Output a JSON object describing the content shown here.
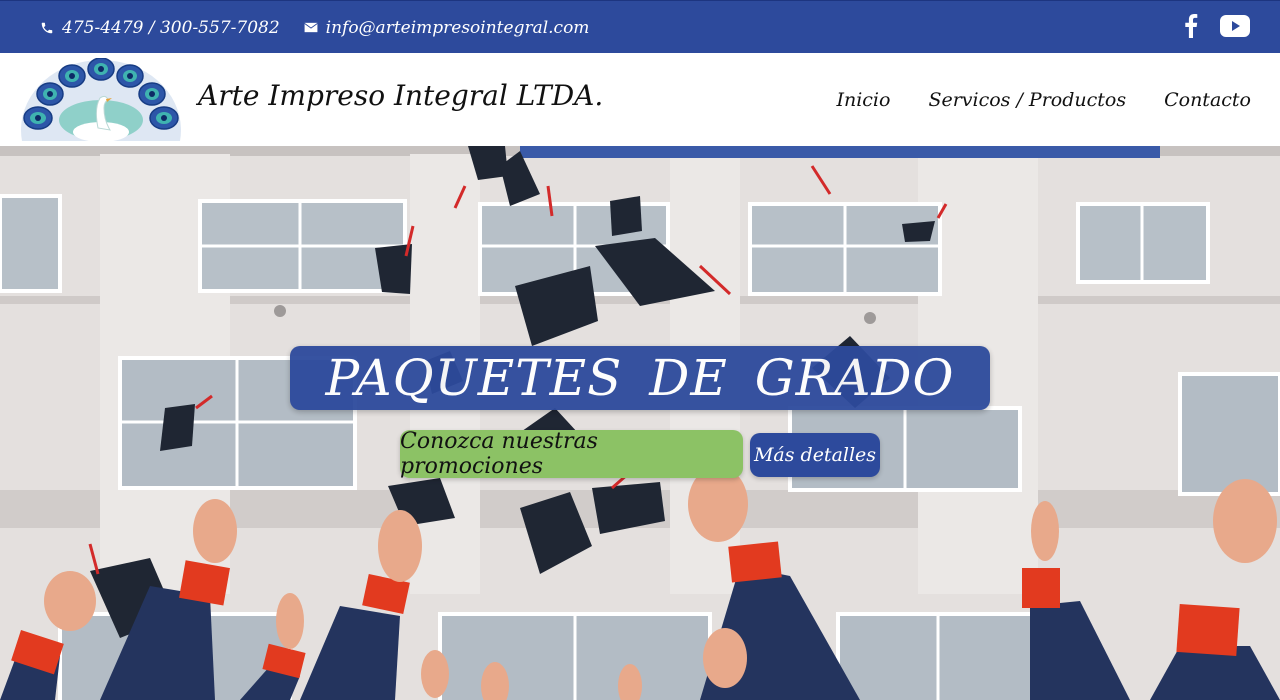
{
  "topbar": {
    "phone": "475-4479 / 300-557-7082",
    "email": "info@arteimpresointegral.com",
    "social_icons": [
      "facebook-icon",
      "youtube-icon"
    ]
  },
  "header": {
    "site_name": "Arte Impreso Integral LTDA.",
    "nav": [
      {
        "label": "Inicio"
      },
      {
        "label": "Servicos / Productos"
      },
      {
        "label": "Contacto"
      }
    ]
  },
  "hero": {
    "headline": "PAQUETES DE GRADO",
    "primary_button": "Conozca nuestras promociones",
    "secondary_button": "Más detalles",
    "background_image": "graduation caps thrown in front of white building"
  },
  "colors": {
    "brand_blue": "#2d4a9c",
    "accent_green": "#8cc265",
    "header_bg": "#ffffff"
  }
}
